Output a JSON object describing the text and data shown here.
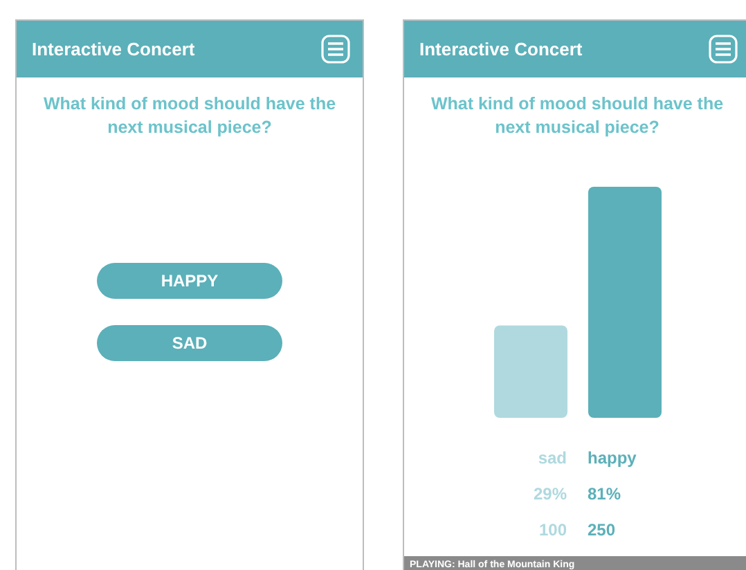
{
  "screens": [
    {
      "kind": "vote",
      "title": "Interactive Concert",
      "question": "What kind of mood should have the next musical piece?",
      "options": [
        "HAPPY",
        "SAD"
      ]
    },
    {
      "kind": "results",
      "title": "Interactive Concert",
      "question": "What kind of mood should have the next musical piece?",
      "chart_data": {
        "type": "bar",
        "categories": [
          "sad",
          "happy"
        ],
        "values": [
          100,
          250
        ],
        "data_labels": true
      },
      "results": [
        {
          "percent": "29%",
          "color": "#afd9df"
        },
        {
          "percent": "81%",
          "color": "#5bb0b9"
        }
      ],
      "status_bar": "PLAYING: Hall of the Mountain King"
    }
  ]
}
